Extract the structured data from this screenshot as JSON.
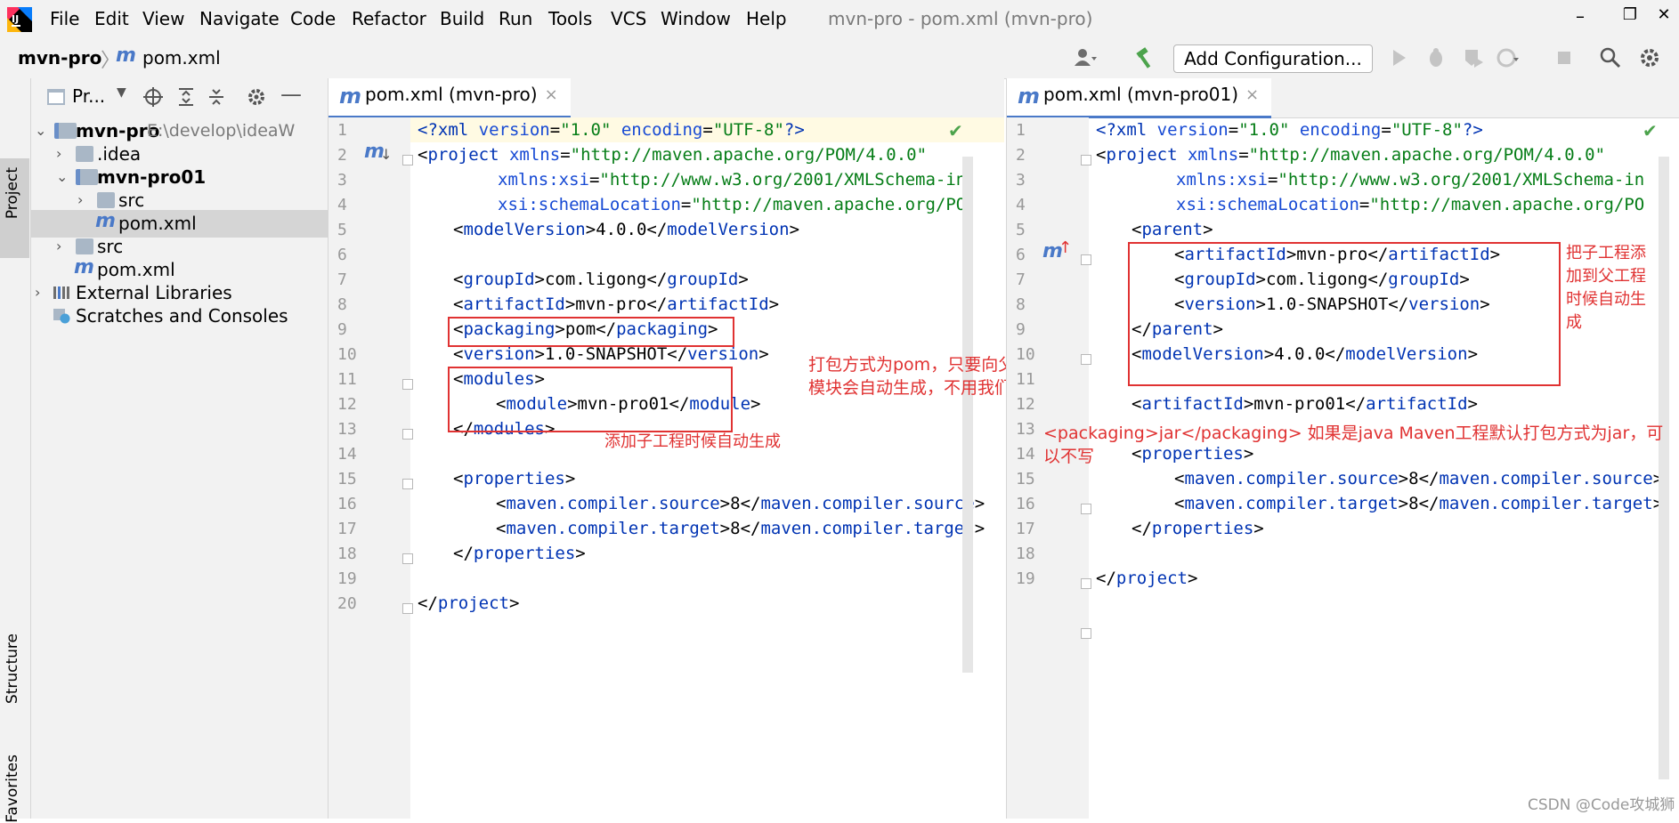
{
  "menubar": {
    "items": [
      "File",
      "Edit",
      "View",
      "Navigate",
      "Code",
      "Refactor",
      "Build",
      "Run",
      "Tools",
      "VCS",
      "Window",
      "Help"
    ],
    "window_title": "mvn-pro - pom.xml (mvn-pro)",
    "minimize": "–",
    "restore": "❐",
    "close": "✕"
  },
  "navbar": {
    "project": "mvn-pro",
    "separator": "〉",
    "file_icon": "m",
    "file": "pom.xml",
    "add_configuration": "Add Configuration..."
  },
  "stripe": {
    "project_tab": "Project",
    "structure_tab": "Structure",
    "favorites_tab": "Favorites"
  },
  "project_panel": {
    "header_label": "Pr...",
    "tree": [
      {
        "label": "mvn-pro",
        "hint": "E:\\develop\\ideaW",
        "bold": true
      },
      {
        "label": ".idea"
      },
      {
        "label": "mvn-pro01",
        "bold": true
      },
      {
        "label": "src"
      },
      {
        "label": "pom.xml",
        "selected": true
      },
      {
        "label": "src"
      },
      {
        "label": "pom.xml"
      },
      {
        "label": "External Libraries"
      },
      {
        "label": "Scratches and Consoles"
      }
    ]
  },
  "editor_left": {
    "tab_title": "pom.xml (mvn-pro)",
    "tab_close": "×",
    "line_numbers": [
      "1",
      "2",
      "3",
      "4",
      "5",
      "6",
      "7",
      "8",
      "9",
      "10",
      "11",
      "12",
      "13",
      "14",
      "15",
      "16",
      "17",
      "18",
      "19",
      "20"
    ],
    "annotations": {
      "packaging_note": "打包方式为pom，只要向父工程中添加子模块会自动生成，不用我们写",
      "modules_note": "添加子工程时候自动生成"
    }
  },
  "editor_right": {
    "tab_title": "pom.xml (mvn-pro01)",
    "tab_close": "×",
    "line_numbers": [
      "1",
      "2",
      "3",
      "4",
      "5",
      "6",
      "7",
      "8",
      "9",
      "10",
      "11",
      "12",
      "13",
      "14",
      "15",
      "16",
      "17",
      "18",
      "19"
    ],
    "annotations": {
      "parent_note": "把子工程添加到父工程时候自动生成",
      "packaging_note": "<packaging>jar</packaging> 如果是java Maven工程默认打包方式为jar，可以不写"
    }
  },
  "code": {
    "xml_decl_open": "<?xml",
    "xml_version_attr": "version",
    "xml_version_val": "\"1.0\"",
    "xml_encoding_attr": "encoding",
    "xml_encoding_val": "\"UTF-8\"",
    "xml_decl_close": "?>",
    "xmlns_attr": "xmlns",
    "xmlns_val": "\"http://maven.apache.org/POM/4.0.0\"",
    "xmlns_xsi_attr": "xmlns:xsi",
    "xmlns_xsi_val": "\"http://www.w3.org/2001/XMLSchema-in",
    "xsi_loc_attr": "xsi:schemaLocation",
    "xsi_loc_val": "\"http://maven.apache.org/PO",
    "model_version": "4.0.0",
    "group_id": "com.ligong",
    "parent_artifact": "mvn-pro",
    "packaging": "pom",
    "version": "1.0-SNAPSHOT",
    "module": "mvn-pro01",
    "compiler_source": "8",
    "compiler_target": "8"
  },
  "watermark": "CSDN @Code攻城狮",
  "colors": {
    "tag": "#0033b3",
    "attr_value": "#067d17",
    "annotation": "#e03232",
    "accent": "#4a79c8"
  }
}
